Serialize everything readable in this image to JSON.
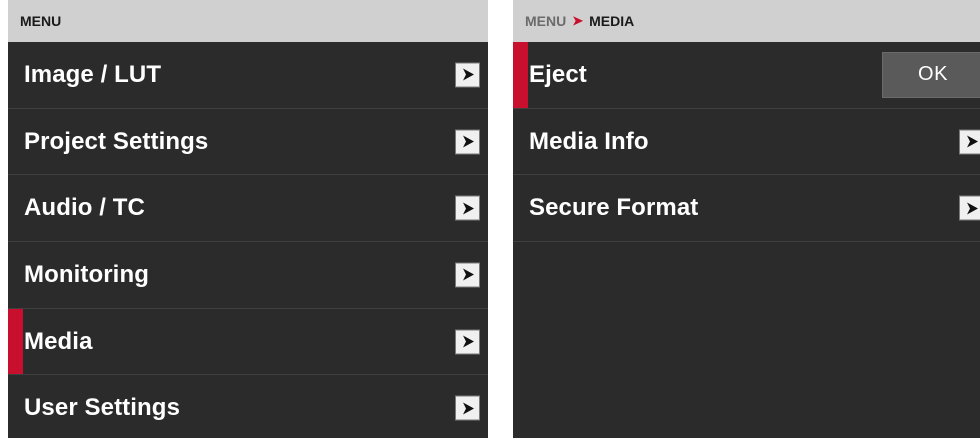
{
  "left_panel": {
    "header": "MENU",
    "items": [
      {
        "label": "Image / LUT"
      },
      {
        "label": "Project Settings"
      },
      {
        "label": "Audio / TC"
      },
      {
        "label": "Monitoring"
      },
      {
        "label": "Media",
        "selected": true
      },
      {
        "label": "User Settings"
      }
    ]
  },
  "right_panel": {
    "breadcrumb": {
      "parent": "MENU",
      "separator": "➤",
      "current": "MEDIA"
    },
    "items": [
      {
        "label": "Eject",
        "selected": true,
        "action_label": "OK"
      },
      {
        "label": "Media Info"
      },
      {
        "label": "Secure Format"
      }
    ]
  },
  "colors": {
    "accent": "#c8102e",
    "panel_bg": "#2b2b2b",
    "header_bg": "#d0d0d0"
  },
  "icons": {
    "submenu_arrow": "chevron-right-icon"
  }
}
